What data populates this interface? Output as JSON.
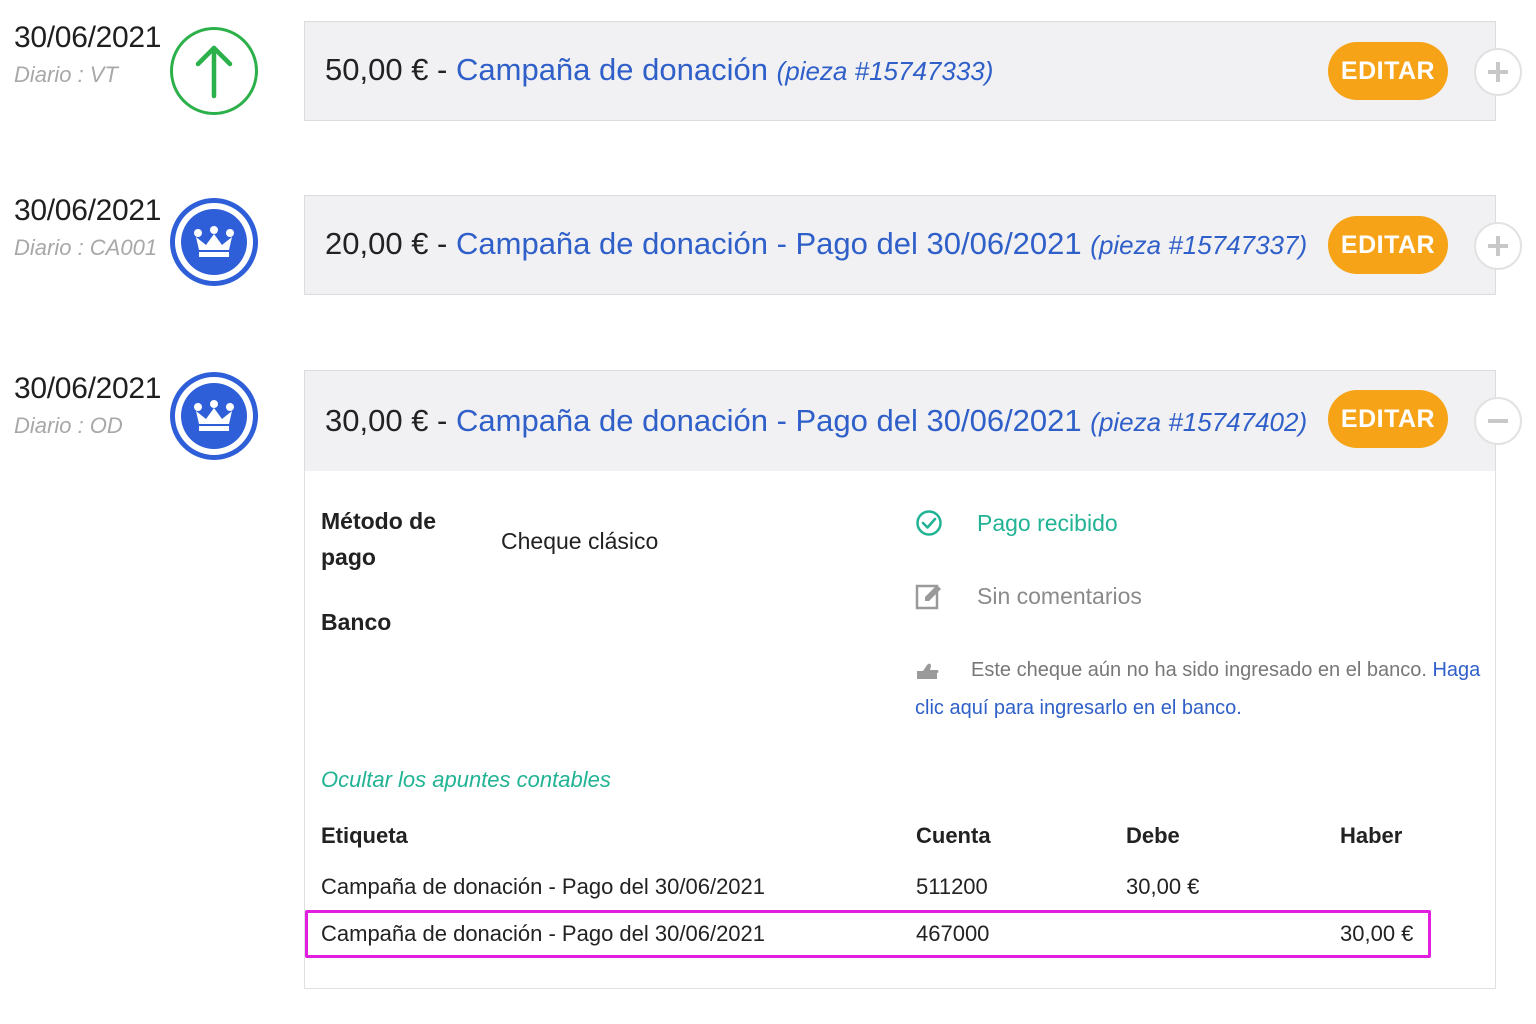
{
  "entries": [
    {
      "date": "30/06/2021",
      "journal": "Diario : VT",
      "icon": "arrow-up-icon",
      "amount": "50,00 €",
      "separator": " - ",
      "title": "Campaña de donación",
      "piece": "(pieza #15747333)",
      "edit_label": "EDITAR",
      "toggle": "+"
    },
    {
      "date": "30/06/2021",
      "journal": "Diario : CA001",
      "icon": "crown-icon",
      "amount": "20,00 €",
      "separator": " - ",
      "title": "Campaña de donación - Pago del 30/06/2021",
      "piece": "(pieza #15747337)",
      "edit_label": "EDITAR",
      "toggle": "+"
    },
    {
      "date": "30/06/2021",
      "journal": "Diario : OD",
      "icon": "crown-icon",
      "amount": "30,00 €",
      "separator": " - ",
      "title": "Campaña de donación - Pago del 30/06/2021",
      "piece": "(pieza #15747402)",
      "edit_label": "EDITAR",
      "toggle": "−"
    }
  ],
  "detail": {
    "method_label_line1": "Método de",
    "method_label_line2": "pago",
    "method_value": "Cheque clásico",
    "bank_label": "Banco",
    "status_received": "Pago recibido",
    "no_comments": "Sin comentarios",
    "bank_note": "Este cheque aún no ha sido ingresado en el banco.",
    "bank_link": "Haga clic aquí para ingresarlo en el banco.",
    "hide_link": "Ocultar los apuntes contables"
  },
  "ledger": {
    "headers": {
      "label": "Etiqueta",
      "account": "Cuenta",
      "debit": "Debe",
      "credit": "Haber"
    },
    "rows": [
      {
        "label": "Campaña de donación - Pago del 30/06/2021",
        "account": "511200",
        "debit": "30,00 €",
        "credit": ""
      },
      {
        "label": "Campaña de donación - Pago del 30/06/2021",
        "account": "467000",
        "debit": "",
        "credit": "30,00 €"
      }
    ]
  },
  "colors": {
    "edit_button": "#f7a318",
    "link": "#2f5fc8",
    "crown_blue": "#2e5fd8",
    "arrow_green": "#2bb04a",
    "teal": "#21b394",
    "highlight": "#e21ee0"
  }
}
